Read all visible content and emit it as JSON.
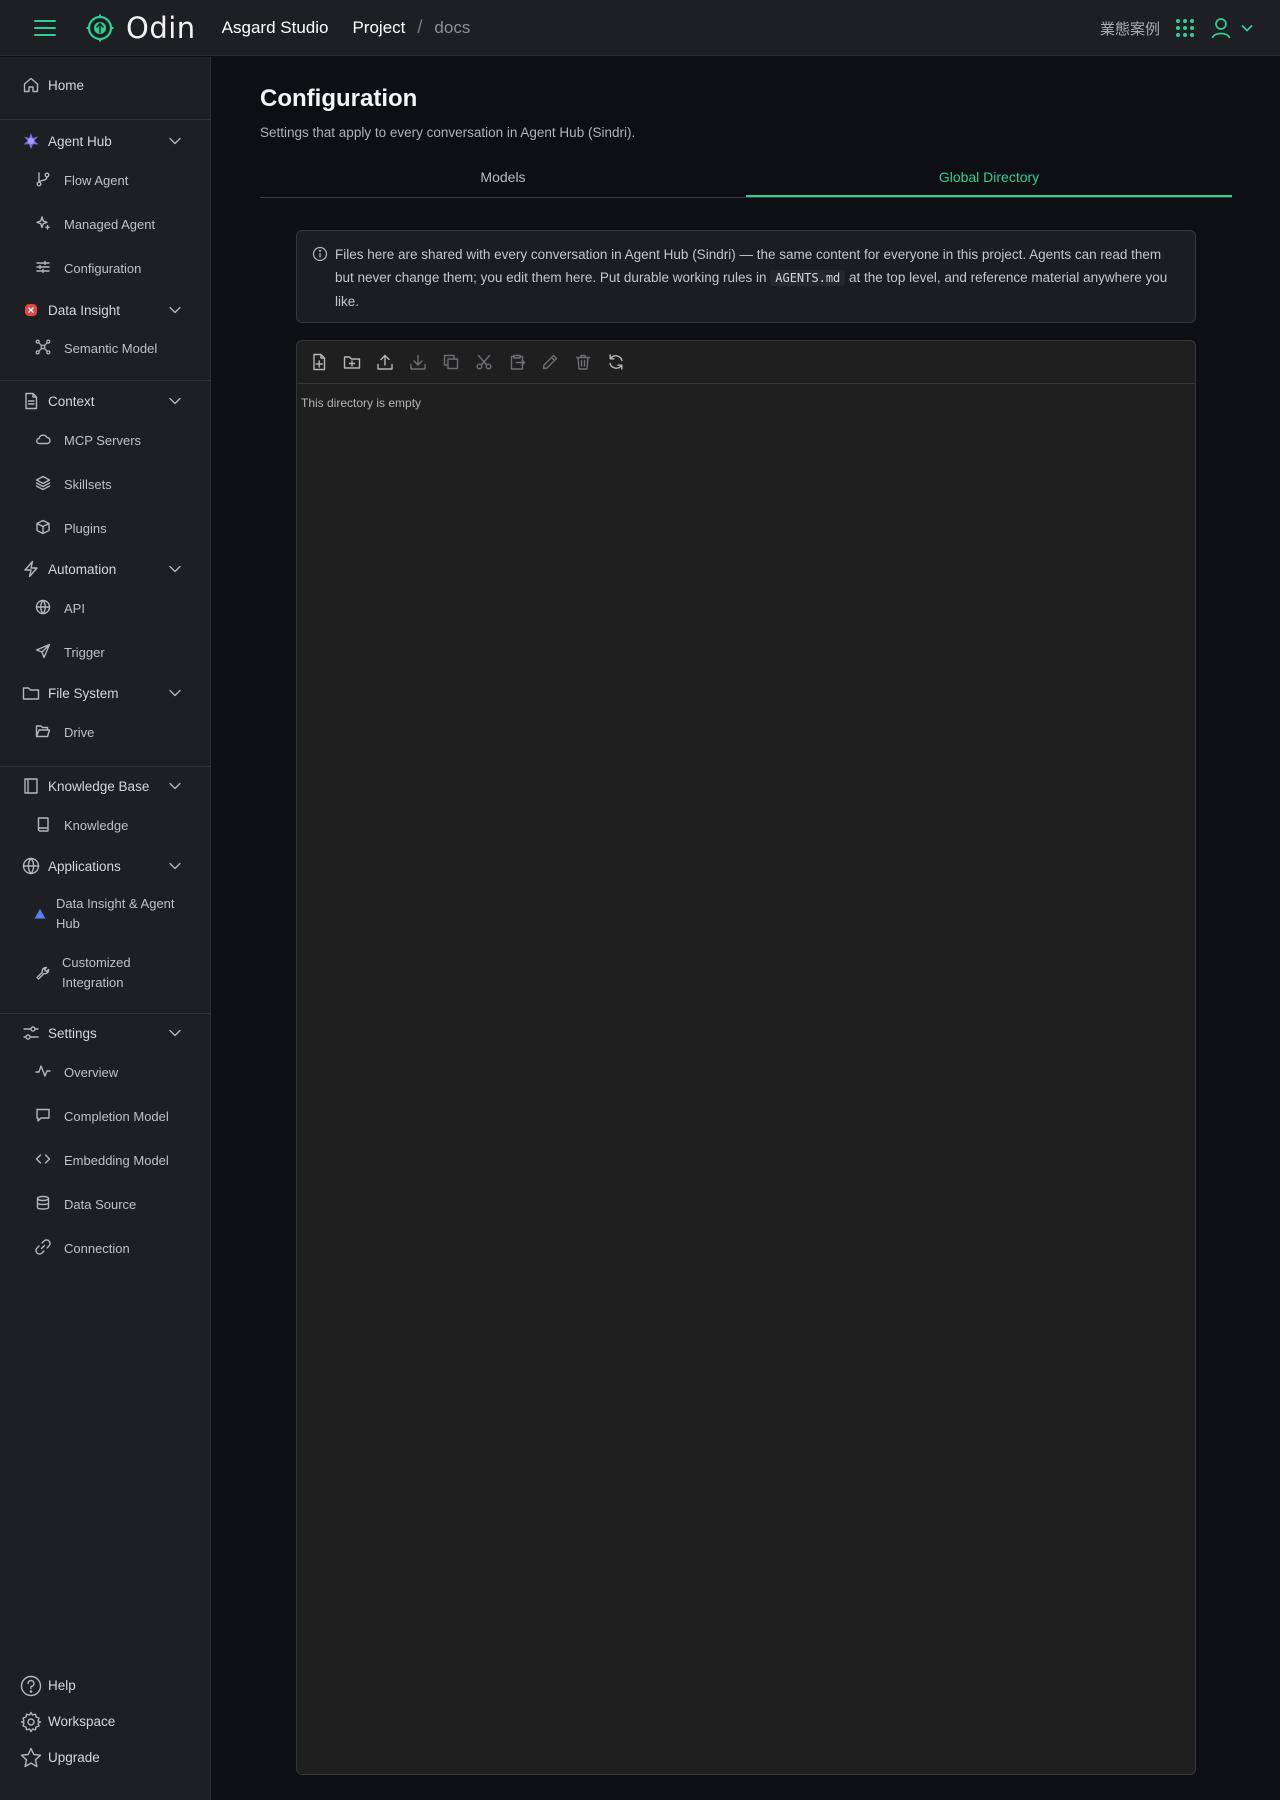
{
  "header": {
    "app_name": "Odin",
    "org_name": "Asgard Studio",
    "breadcrumb": [
      "Project",
      "/",
      "docs"
    ],
    "case_link": "業態案例",
    "accent_color": "#2ecf93",
    "icons": [
      "menu-icon",
      "odin-logo-icon",
      "apps-grid-icon",
      "user-icon",
      "chevron-down-icon"
    ]
  },
  "sidebar": {
    "home": "Home",
    "agent_hub": {
      "label": "Agent Hub",
      "items": [
        "Flow Agent",
        "Managed Agent",
        "Configuration"
      ]
    },
    "data_insight": {
      "label": "Data Insight",
      "items": [
        "Semantic Model"
      ]
    },
    "context": {
      "label": "Context",
      "items": [
        "MCP Servers",
        "Skillsets",
        "Plugins"
      ]
    },
    "automation": {
      "label": "Automation",
      "items": [
        "API",
        "Trigger"
      ]
    },
    "file_system": {
      "label": "File System",
      "items": [
        "Drive"
      ]
    },
    "knowledge_base": {
      "label": "Knowledge Base",
      "items": [
        "Knowledge"
      ]
    },
    "applications": {
      "label": "Applications",
      "items": [
        "Data Insight & Agent Hub",
        "Customized Integration"
      ]
    },
    "settings": {
      "label": "Settings",
      "items": [
        "Overview",
        "Completion Model",
        "Embedding Model",
        "Data Source",
        "Connection"
      ]
    },
    "footer": [
      "Help",
      "Workspace",
      "Upgrade"
    ]
  },
  "main": {
    "title": "Configuration",
    "subtitle": "Settings that apply to every conversation in Agent Hub (Sindri).",
    "tabs": [
      "Models",
      "Global Directory"
    ],
    "active_tab": "Global Directory",
    "info": {
      "before": "Files here are shared with every conversation in Agent Hub (Sindri) — the same content for everyone in this project. Agents can read them but never change them; you edit them here. Put durable working rules in ",
      "code": "AGENTS.md",
      "after": " at the top level, and reference material anywhere you like."
    },
    "file_manager": {
      "toolbar": [
        "new-file",
        "new-folder",
        "upload",
        "download",
        "copy",
        "cut",
        "paste",
        "rename",
        "delete",
        "refresh"
      ],
      "empty_text": "This directory is empty"
    }
  }
}
